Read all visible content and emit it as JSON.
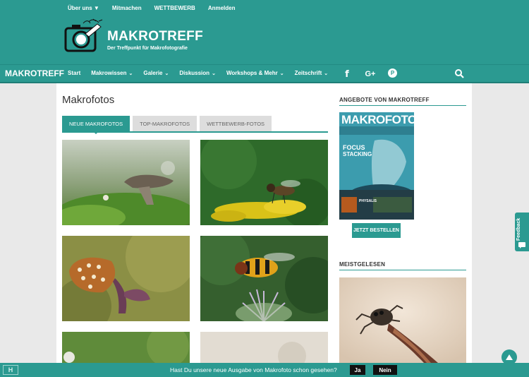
{
  "top_links": [
    "Über uns ▼",
    "Mitmachen",
    "WETTBEWERB",
    "Anmelden"
  ],
  "brand": {
    "title": "MAKROTREFF",
    "subtitle": "Der Treffpunkt für Makrofotografie"
  },
  "nav": {
    "brand": "MAKROTREFF",
    "items": [
      {
        "label": "Start",
        "chevron": ""
      },
      {
        "label": "Makrowissen",
        "chevron": "⌄"
      },
      {
        "label": "Galerie",
        "chevron": "⌄"
      },
      {
        "label": "Diskussion",
        "chevron": "⌄"
      },
      {
        "label": "Workshops & Mehr",
        "chevron": "⌄"
      },
      {
        "label": "Zeitschrift",
        "chevron": "⌄"
      }
    ],
    "social": {
      "facebook": "f",
      "google": "G+",
      "pinterest": "P"
    },
    "search_icon": "search-icon"
  },
  "main": {
    "title": "Makrofotos",
    "tabs": [
      "NEUE MAKROFOTOS",
      "TOP-MAKROFOTOS",
      "WETTBEWERB-FOTOS"
    ],
    "photos": [
      "mushroom-photo",
      "hoverfly-photo",
      "butterfly-photo",
      "wasp-fly-photo",
      "green-photo",
      "beige-photo"
    ]
  },
  "sidebar": {
    "offers_heading": "ANGEBOTE VON MAKROTREFF",
    "magazine": {
      "title": "MAKROFOTO",
      "cover_line1": "FOCUS",
      "cover_line2": "STACKING",
      "cover_small": "PHYSALIS"
    },
    "order_button": "JETZT BESTELLEN",
    "popular_heading": "MEISTGELESEN"
  },
  "feedback_label": "Feedback",
  "bottom_bar": {
    "icon_label": "H",
    "question": "Hast Du unsere neue Ausgabe von Makrofoto schon gesehen?",
    "yes": "Ja",
    "no": "Nein"
  },
  "colors": {
    "accent": "#2b9a91",
    "dark": "#111111"
  }
}
